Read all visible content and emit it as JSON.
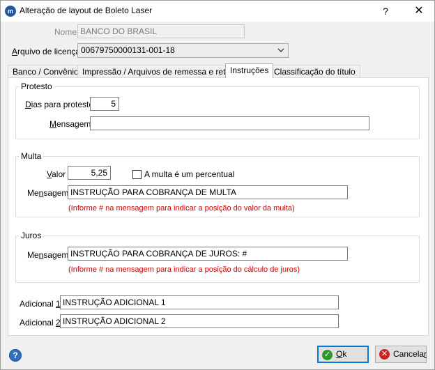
{
  "window": {
    "title": "Alteração de layout de Boleto Laser",
    "help_glyph": "?",
    "close_glyph": "✕"
  },
  "form": {
    "nome_label": "Nome",
    "nome_value": "BANCO DO BRASIL",
    "arquivo_label_pre": "A",
    "arquivo_label_rest": "rquivo de licença",
    "arquivo_value": "00679750000131-001-18"
  },
  "tabs": [
    {
      "label": "Banco / Convênio"
    },
    {
      "label": "Impressão / Arquivos de remessa e retorno"
    },
    {
      "label": "Instruções"
    },
    {
      "label": "Classificação do título"
    }
  ],
  "protesto": {
    "group_title": "Protesto",
    "dias_label_pre": "D",
    "dias_label_rest": "ias para protesto",
    "dias_value": "5",
    "mensagem_label_pre": "M",
    "mensagem_label_rest": "ensagem",
    "mensagem_value": ""
  },
  "multa": {
    "group_title": "Multa",
    "valor_label_pre": "V",
    "valor_label_rest": "alor",
    "valor_value": "5,25",
    "percent_checkbox_label": "A multa é um percentual",
    "percent_checked": false,
    "mensagem_label_pre": "Me",
    "mensagem_label_u": "n",
    "mensagem_label_rest": "sagem",
    "mensagem_value": "INSTRUÇÃO PARA COBRANÇA DE MULTA",
    "hint": "(Informe # na mensagem para indicar a posição do valor da multa)"
  },
  "juros": {
    "group_title": "Juros",
    "mensagem_label_pre": "Me",
    "mensagem_label_u": "n",
    "mensagem_label_rest": "sagem",
    "mensagem_value": "INSTRUÇÃO PARA COBRANÇA DE JUROS: #",
    "hint": "(Informe # na mensagem para indicar a posição do cálculo de juros)"
  },
  "adicional": {
    "label1_pre": "Adicional ",
    "label1_u": "1",
    "value1": "INSTRUÇÃO ADICIONAL 1",
    "label2_pre": "Adicional ",
    "label2_u": "2",
    "value2": "INSTRUÇÃO ADICIONAL 2"
  },
  "footer": {
    "help_glyph": "?",
    "ok_label_pre": "O",
    "ok_label_rest": "k",
    "ok_icon": "check-icon",
    "cancel_label_pre": "Cancela",
    "cancel_label_u": "r",
    "cancel_icon": "cancel-x-icon",
    "accent_color": "#0078d7"
  }
}
